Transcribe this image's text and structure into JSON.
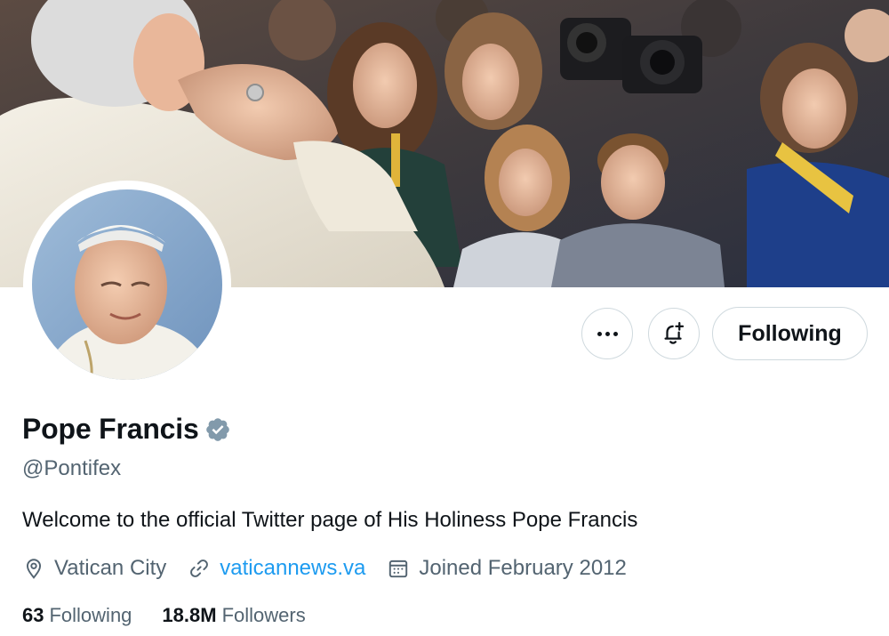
{
  "profile": {
    "display_name": "Pope Francis",
    "handle": "@Pontifex",
    "bio": "Welcome to the official Twitter page of His Holiness Pope Francis",
    "location": "Vatican City",
    "website": "vaticannews.va",
    "joined": "Joined February 2012",
    "following_count": "63",
    "following_label": "Following",
    "followers_count": "18.8M",
    "followers_label": "Followers"
  },
  "actions": {
    "follow_label": "Following"
  },
  "icons": {
    "more": "more-icon",
    "notify": "bell-plus-icon",
    "verified": "verified-badge-icon",
    "location": "location-pin-icon",
    "link": "link-icon",
    "calendar": "calendar-icon"
  },
  "colors": {
    "accent": "#1d9bf0",
    "verified_badge": "#829aab",
    "secondary_text": "#536471",
    "primary_text": "#0f1419"
  }
}
